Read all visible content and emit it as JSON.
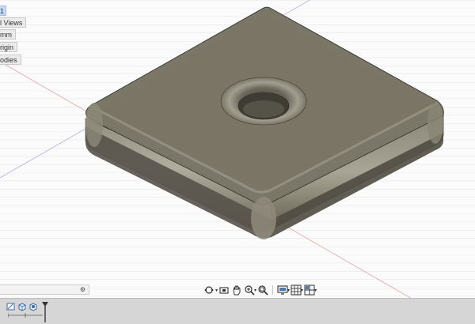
{
  "browser": {
    "nodes": [
      "1",
      "l Views",
      "mm",
      "rigin",
      "odies"
    ]
  },
  "icons": {
    "comment_settings": "gear-icon",
    "nav_toolbar": [
      "orbit-icon",
      "look-at-icon",
      "pan-icon",
      "zoom-icon",
      "zoom-fit-icon",
      "display-settings-icon",
      "grid-settings-icon",
      "viewports-icon"
    ],
    "timeline": [
      "timeline-sketch-icon",
      "timeline-extrude-icon",
      "timeline-fillet-icon",
      "timeline-marker-icon"
    ]
  },
  "colors": {
    "viewport_bg": "#fbfbfb",
    "grid_line": "#dcdcdc",
    "model_top": "#7b7768",
    "model_side": "#5e5a4d",
    "axis_red": "#e7a3a3",
    "axis_blue": "#a9b4dd",
    "selection_blue": "#c7dcf2"
  }
}
